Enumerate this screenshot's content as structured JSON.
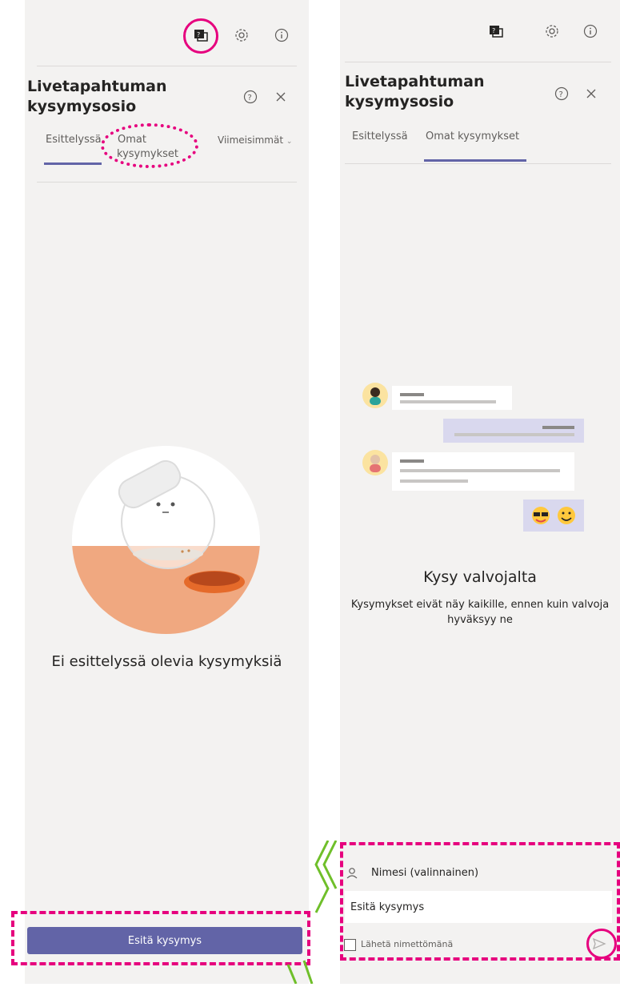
{
  "left_panel": {
    "title": "Livetapahtuman kysymysosio",
    "title_line1": "Livetapahtuman",
    "title_line2": "kysymysosio",
    "tabs": [
      {
        "label": "Esittelyssä",
        "active": true
      },
      {
        "label": "Omat kysymykset",
        "line1": "Omat",
        "line2": "kysymykset",
        "active": false
      }
    ],
    "sort_label": "Viimeisimmät",
    "empty_message": "Ei esittelyssä olevia kysymyksiä",
    "ask_button": "Esitä kysymys",
    "icons": [
      "qa-icon",
      "gear-icon",
      "info-icon",
      "help-icon",
      "close-icon",
      "chevron-down-icon"
    ]
  },
  "right_panel": {
    "title_line1": "Livetapahtuman",
    "title_line2": "kysymysosio",
    "tabs": [
      {
        "label": "Esittelyssä",
        "active": false
      },
      {
        "label": "Omat kysymykset",
        "active": true
      }
    ],
    "empty_title": "Kysy valvojalta",
    "empty_sub_line1": "Kysymykset eivät näy kaikille, ennen kuin valvoja",
    "empty_sub_line2": "hyväksyy ne",
    "name_placeholder": "Nimesi (valinnainen)",
    "question_placeholder": "Esitä kysymys",
    "anonymous_label": "Lähetä nimettömänä",
    "icons": [
      "qa-icon",
      "gear-icon",
      "info-icon",
      "help-icon",
      "close-icon",
      "person-icon",
      "send-icon"
    ]
  },
  "colors": {
    "accent": "#6264a7",
    "highlight": "#e6007e",
    "panel_bg": "#f3f2f1"
  }
}
